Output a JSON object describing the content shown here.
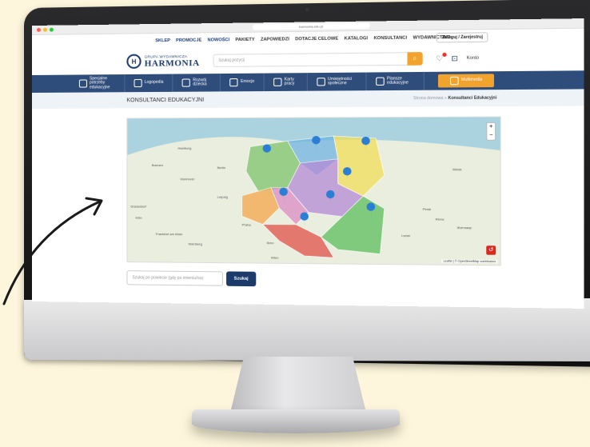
{
  "browser": {
    "url": "harmonia.edu.pl"
  },
  "topnav": {
    "items": [
      "SKLEP",
      "PROMOCJE",
      "NOWOŚCI",
      "PAKIETY",
      "ZAPOWIEDZI",
      "DOTACJE CELOWE",
      "KATALOGI",
      "KONSULTANCI",
      "WYDAWNICTWO"
    ],
    "login": "Zaloguj / Zarejestruj"
  },
  "logo": {
    "top": "GRUPA WYDAWNICZA",
    "main": "HARMONIA"
  },
  "search": {
    "placeholder": "Szukaj pozycji"
  },
  "account": {
    "label": "Konto"
  },
  "categories": [
    "Specjalne potrzeby edukacyjne",
    "Logopedia",
    "Rozwój dziecka",
    "Emocje",
    "Karty pracy",
    "Umiejętności społeczne",
    "Plansze edukacyjne",
    "Multimedia"
  ],
  "page": {
    "title": "KONSULTANCI EDUKACYJNI",
    "breadcrumb_home": "Strona domowa",
    "breadcrumb_sep": "»",
    "breadcrumb_current": "Konsultanci Edukacyjni"
  },
  "map": {
    "attribution": "Leaflet | © OpenStreetMap contributors",
    "cities": [
      "Hamburg",
      "Bremen",
      "Berlin",
      "Hannover",
      "Leipzig",
      "Düsseldorf",
      "Köln",
      "Frankfurt am Main",
      "Nürnberg",
      "Praha",
      "Brno",
      "Wien",
      "Lwów",
      "Minsk",
      "Pinsk",
      "Rivne",
      "Житомир"
    ],
    "region_colors": [
      "#7cc36a",
      "#6fb3e0",
      "#f2dd5a",
      "#f4a64a",
      "#b48ad6",
      "#d98bc2",
      "#e0504a",
      "#5bbd5b"
    ]
  },
  "consultant_search": {
    "placeholder": "Szukaj po powiecie (gdy po imieniu/naz",
    "button": "Szukaj"
  }
}
